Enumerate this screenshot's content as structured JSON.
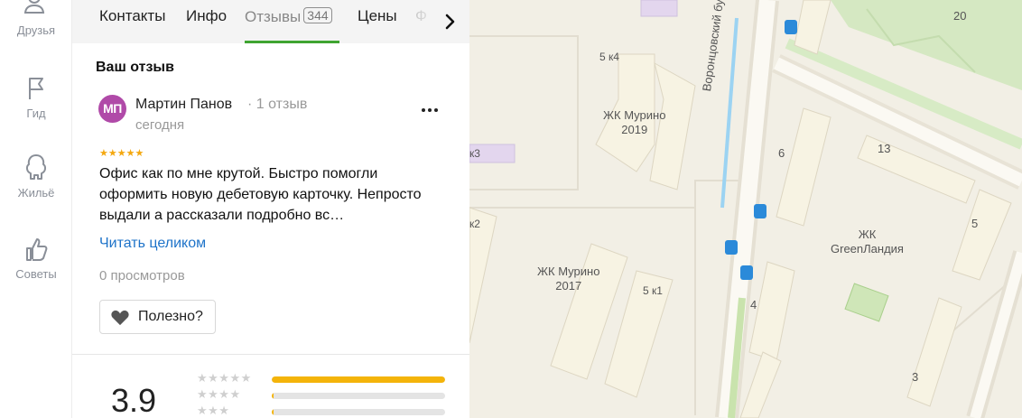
{
  "rail": {
    "items": [
      {
        "label": "Друзья",
        "icon": "friends-icon"
      },
      {
        "label": "Гид",
        "icon": "flag-icon"
      },
      {
        "label": "Жильё",
        "icon": "house-icon"
      },
      {
        "label": "Советы",
        "icon": "thumbs-up-icon"
      }
    ]
  },
  "tabs": {
    "items": [
      {
        "label": "Контакты"
      },
      {
        "label": "Инфо"
      },
      {
        "label": "Отзывы",
        "badge": "344",
        "active": true
      },
      {
        "label": "Цены"
      },
      {
        "label": "Ф"
      }
    ],
    "next_icon": "chevron-right-icon"
  },
  "review_section": {
    "title": "Ваш отзыв",
    "author_initials": "МП",
    "author_name": "Мартин Панов",
    "author_meta": "· 1 отзыв",
    "date": "сегодня",
    "stars": "★★★★★",
    "rating": 5,
    "text": "Офис как по мне крутой. Быстро помогли оформить новую дебетовую карточку. Непросто выдали а рассказали подробно вс…",
    "read_more": "Читать целиком",
    "views": "0 просмотров",
    "helpful_label": "Полезно?",
    "helpful_icon": "heart-icon",
    "more_icon": "more-dots-icon"
  },
  "rating_summary": {
    "value": "3.9",
    "distribution": [
      {
        "stars": "★★★★★",
        "fraction": 1.0
      },
      {
        "stars": "★★★★",
        "fraction": 0.01
      },
      {
        "stars": "★★★",
        "fraction": 0.01
      }
    ]
  },
  "map": {
    "labels": [
      {
        "text": "5 к4"
      },
      {
        "text": "ЖК Мурино\n2019"
      },
      {
        "text": "Воронцовский бульвар"
      },
      {
        "text": "20"
      },
      {
        "text": "6"
      },
      {
        "text": "13"
      },
      {
        "text": "5"
      },
      {
        "text": "ЖК\nGreenЛандия"
      },
      {
        "text": "ЖК Мурино\n2017"
      },
      {
        "text": "5 к1"
      },
      {
        "text": "4"
      },
      {
        "text": "3"
      },
      {
        "text": "к3"
      },
      {
        "text": "к2"
      }
    ]
  },
  "colors": {
    "accent_green": "#3fa431",
    "link_blue": "#1e73c9",
    "star_yellow": "#f4a810",
    "avatar_purple": "#b04aa8"
  }
}
